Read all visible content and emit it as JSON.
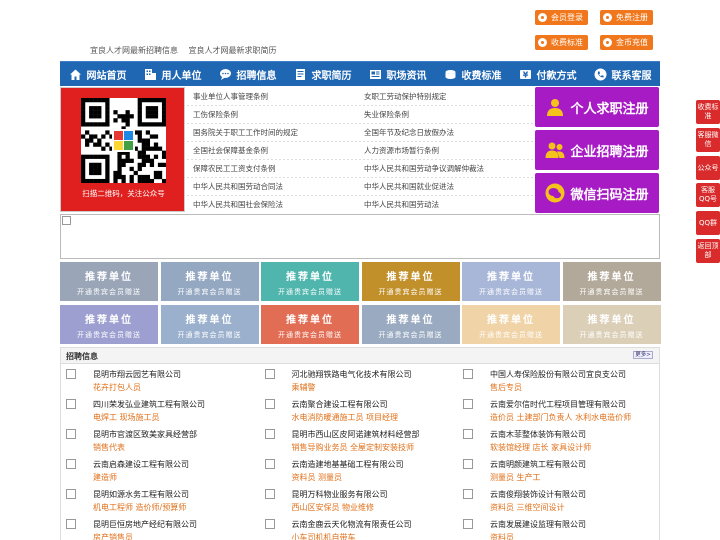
{
  "header": {
    "links": [
      "宜良人才网最新招聘信息",
      "宜良人才网最新求职简历"
    ],
    "buttons": [
      "会员登录",
      "免费注册",
      "收费标准",
      "金币充值"
    ]
  },
  "nav": {
    "items": [
      {
        "label": "网站首页",
        "icon": "home-icon"
      },
      {
        "label": "用人单位",
        "icon": "building-icon"
      },
      {
        "label": "招聘信息",
        "icon": "chat-icon"
      },
      {
        "label": "求职简历",
        "icon": "resume-icon"
      },
      {
        "label": "职场资讯",
        "icon": "news-icon"
      },
      {
        "label": "收费标准",
        "icon": "coin-icon"
      },
      {
        "label": "付款方式",
        "icon": "yen-icon"
      },
      {
        "label": "联系客服",
        "icon": "phone-icon"
      }
    ]
  },
  "qr": {
    "caption": "扫描二维码，关注公众号"
  },
  "policies": {
    "left": [
      "事业单位人事管理条例",
      "工伤保险条例",
      "国务院关于职工工作时间的规定",
      "全国社会保障基金条例",
      "保障农民工工资支付条例",
      "中华人民共和国劳动合同法",
      "中华人民共和国社会保险法"
    ],
    "right": [
      "女职工劳动保护特别规定",
      "失业保险条例",
      "全国年节及纪念日放假办法",
      "人力资源市场暂行条例",
      "中华人民共和国劳动争议调解仲裁法",
      "中华人民共和国就业促进法",
      "中华人民共和国劳动法"
    ]
  },
  "register": [
    "个人求职注册",
    "企业招聘注册",
    "微信扫码注册"
  ],
  "recommend": {
    "title": "推荐单位",
    "subtitle": "开通贵宾会员赠送",
    "colors": [
      "#9aa6b8",
      "#94a8c2",
      "#4fb5ad",
      "#c2902b",
      "#a8b6d8",
      "#b3a99a",
      "#9c9fd0",
      "#9ab0cc",
      "#e26d55",
      "#9aabc1",
      "#f0d3a6",
      "#dccfb8"
    ]
  },
  "jobs": {
    "title": "招聘信息",
    "more": "更多>",
    "items": [
      {
        "company": "昆明市翔云园艺有限公司",
        "position": "花卉打包人员"
      },
      {
        "company": "河北驰翔铁路电气化技术有限公司",
        "position": "乘辅警"
      },
      {
        "company": "中国人寿保险股份有限公司宜良支公司",
        "position": "售后专员"
      },
      {
        "company": "四川荣发弘业建筑工程有限公司",
        "position": "电焊工 现场施工员"
      },
      {
        "company": "云南聚合建设工程有限公司",
        "position": "水电消防暖通施工员 项目经理"
      },
      {
        "company": "云南爱尔信时代工程项目管理有限公司",
        "position": "造价员 土建部门负责人 水利水电造价师"
      },
      {
        "company": "昆明市官渡区致美家具经营部",
        "position": "销售代表"
      },
      {
        "company": "昆明市西山区皮阿诺建筑材料经营部",
        "position": "销售导购业务员 全屋定制安装技师"
      },
      {
        "company": "云南木菲整体装饰有限公司",
        "position": "软装馆经理 店长 家具设计师"
      },
      {
        "company": "云南启森建设工程有限公司",
        "position": "建造师"
      },
      {
        "company": "云南造建地基基础工程有限公司",
        "position": "资料员 测量员"
      },
      {
        "company": "云南明颜建筑工程有限公司",
        "position": "测量员 生产工"
      },
      {
        "company": "昆明如源水务工程有限公司",
        "position": "机电工程师 造价师/预算师"
      },
      {
        "company": "昆明万科物业服务有限公司",
        "position": "西山区安保员 物业维修"
      },
      {
        "company": "云南俊翔装饰设计有限公司",
        "position": "资料员 三维空间设计"
      },
      {
        "company": "昆明巨恒房地产经纪有限公司",
        "position": "房产销售员"
      },
      {
        "company": "云南金鹿云天化物流有限责任公司",
        "position": "小车司机机自带车"
      },
      {
        "company": "云南发展建设监理有限公司",
        "position": "资料员"
      }
    ]
  },
  "float": [
    "收费标准",
    "客服微信",
    "公众号",
    "客服QQ号",
    "QQ群",
    "返回顶部"
  ]
}
